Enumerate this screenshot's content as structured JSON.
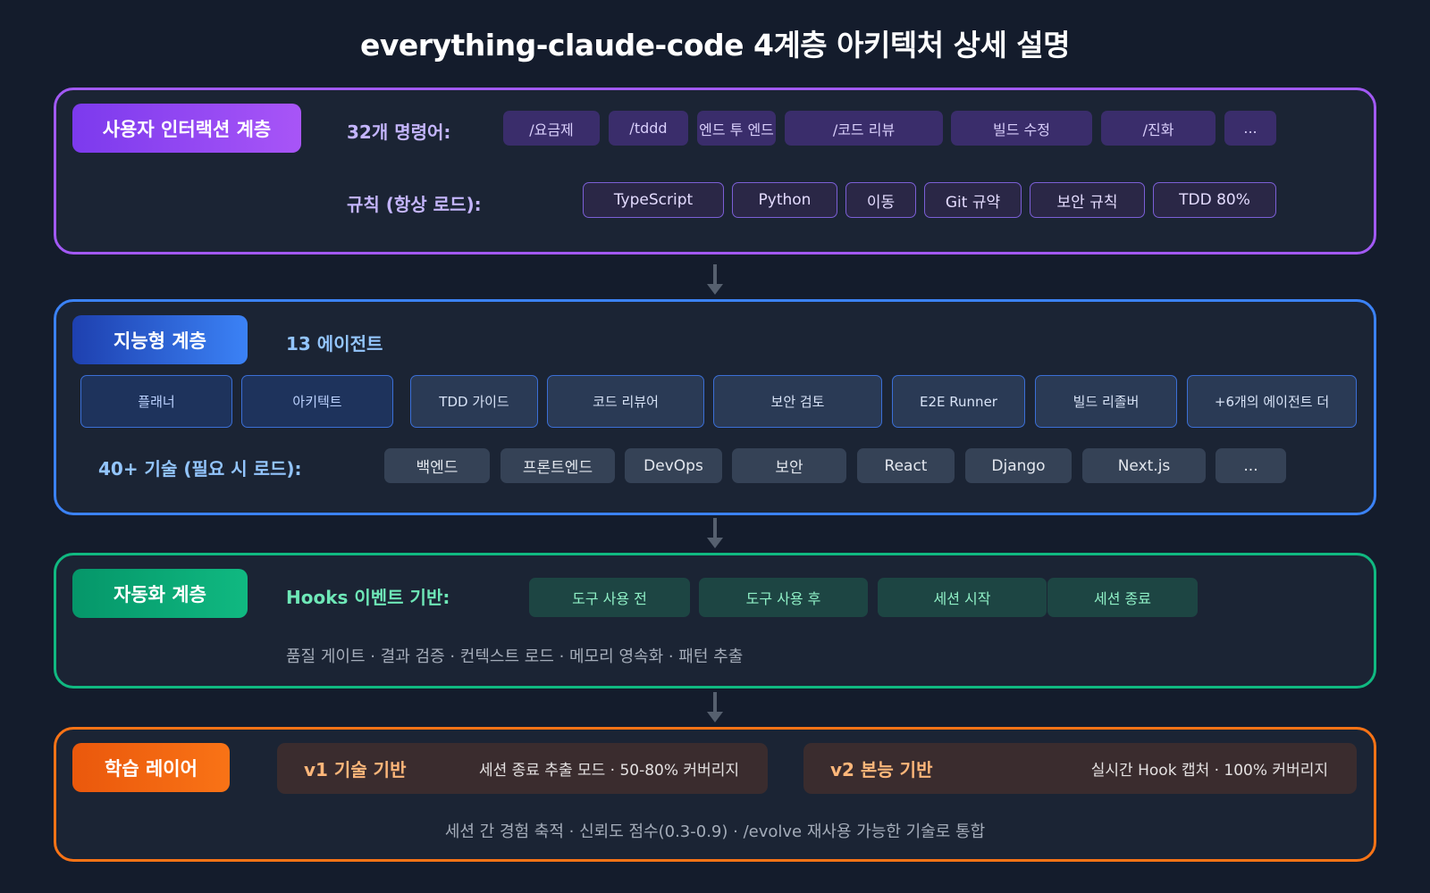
{
  "title": "everything-claude-code 4계층 아키텍처 상세 설명",
  "layer1": {
    "badge": "사용자 인터랙션 계층",
    "commands_label": "32개 명령어:",
    "commands": [
      "/요금제",
      "/tddd",
      "엔드 투 엔드",
      "/코드 리뷰",
      "빌드 수정",
      "/진화",
      "..."
    ],
    "rules_label": "규칙 (항상 로드):",
    "rules": [
      "TypeScript",
      "Python",
      "이동",
      "Git 규약",
      "보안 규칙",
      "TDD 80%"
    ]
  },
  "layer2": {
    "badge": "지능형 계층",
    "agents_label": "13 에이전트",
    "agents": [
      "플래너",
      "아키텍트",
      "TDD 가이드",
      "코드 리뷰어",
      "보안 검토",
      "E2E Runner",
      "빌드 리졸버",
      "+6개의 에이전트 더"
    ],
    "skills_label": "40+ 기술 (필요 시 로드):",
    "skills": [
      "백엔드",
      "프론트엔드",
      "DevOps",
      "보안",
      "React",
      "Django",
      "Next.js",
      "..."
    ]
  },
  "layer3": {
    "badge": "자동화 계층",
    "hooks_label": "Hooks 이벤트 기반:",
    "hooks": [
      "도구 사용 전",
      "도구 사용 후",
      "세션 시작",
      "세션 종료"
    ],
    "description": "품질 게이트 · 결과 검증 · 컨텍스트 로드 · 메모리 영속화 · 패턴 추출"
  },
  "layer4": {
    "badge": "학습 레이어",
    "v1_title": "v1 기술 기반",
    "v1_desc": "세션 종료 추출 모드 · 50-80% 커버리지",
    "v2_title": "v2 본능 기반",
    "v2_desc": "실시간 Hook 캡처 · 100% 커버리지",
    "description": "세션 간 경험 축적 · 신뢰도 점수(0.3-0.9) · /evolve 재사용 가능한 기술로 통합"
  },
  "colors": {
    "background": "#141c2c",
    "layer1_border": "#a259f4",
    "layer2_border": "#3b82f6",
    "layer3_border": "#10b981",
    "layer4_border": "#f97316"
  }
}
